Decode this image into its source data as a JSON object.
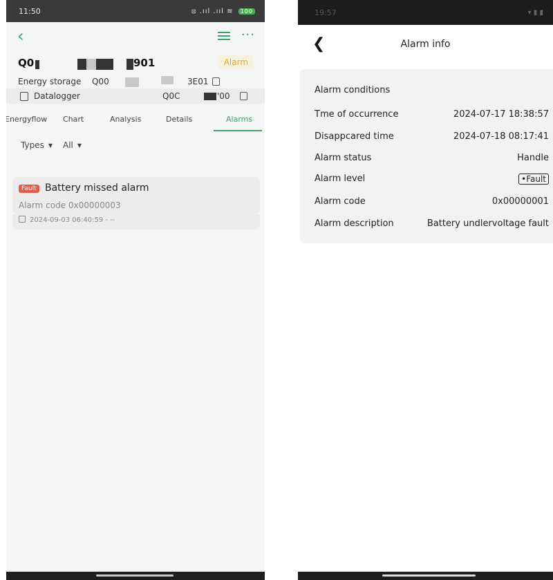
{
  "left": {
    "status": {
      "time": "11:50",
      "icons": "⦻ .ııl .ııl ≋",
      "battery": "100"
    },
    "device": {
      "name_prefix": "Q0",
      "name_suffix": "901",
      "status": "Alarm"
    },
    "energy_storage": {
      "label": "Energy storage",
      "value_prefix": "Q00",
      "value_suffix": "3E01"
    },
    "datalogger": {
      "label": "Datalogger",
      "value_prefix": "Q0C",
      "value_suffix": "'00"
    },
    "tabs": [
      "Energyflow",
      "Chart",
      "Analysis",
      "Details",
      "Alarms"
    ],
    "active_tab": "Alarms",
    "filters": {
      "types": "Types",
      "all": "All"
    },
    "alarm_card": {
      "tag": "Fault",
      "title": "Battery missed alarm",
      "code": "Alarm code  0x00000003",
      "time": "2024-09-03 06:40:59  -  --"
    }
  },
  "right": {
    "status": {
      "time": "19:57"
    },
    "header": {
      "back": "❮",
      "title": "Alarm info"
    },
    "rows": [
      {
        "key": "Alarm conditions",
        "value": ""
      },
      {
        "key": "Tme of occurrence",
        "value": "2024-07-17 18:38:57"
      },
      {
        "key": "Disappcared time",
        "value": "2024-07-18 08:17:41"
      },
      {
        "key": "Alarm status",
        "value": "Handle"
      },
      {
        "key": "Alarm level",
        "value": "•Fault"
      },
      {
        "key": "Alarm code",
        "value": "0x00000001"
      },
      {
        "key": "Alarm description",
        "value": "Battery undlervoltage fault"
      }
    ]
  },
  "colors": {
    "accent": "#3aa56b",
    "fault": "#e55b4b",
    "alarm_badge_text": "#e0a92d"
  }
}
